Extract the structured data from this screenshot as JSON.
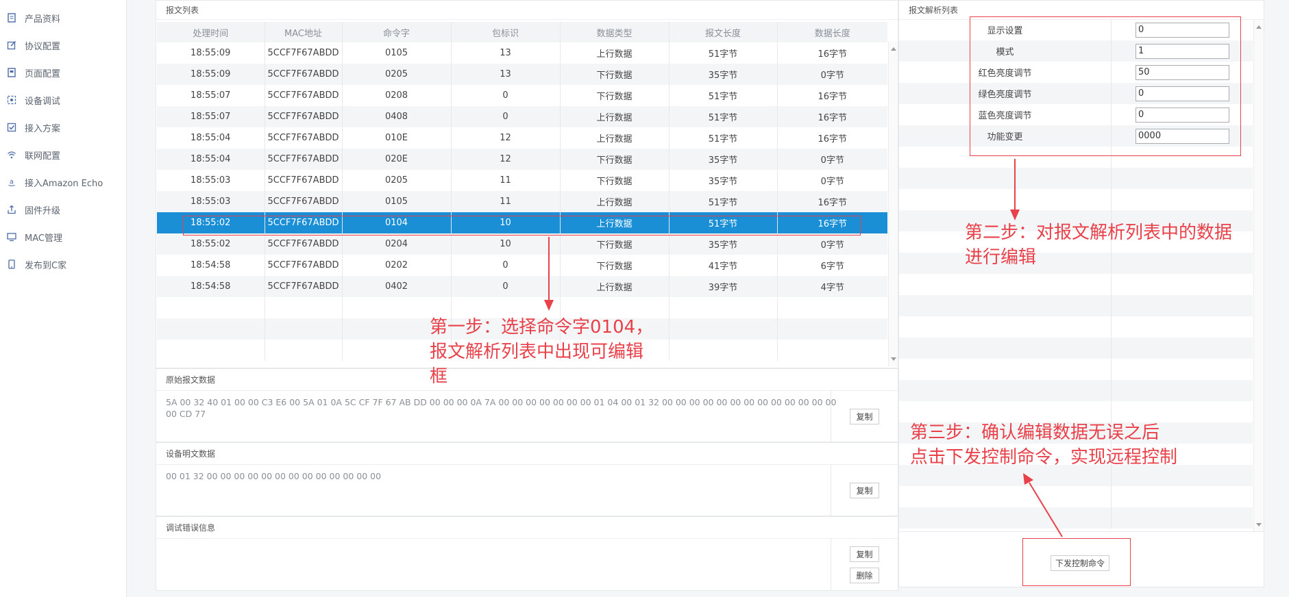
{
  "sidebar": {
    "items": [
      {
        "label": "产品资料",
        "icon": "document-icon"
      },
      {
        "label": "协议配置",
        "icon": "edit-icon"
      },
      {
        "label": "页面配置",
        "icon": "page-icon"
      },
      {
        "label": "设备调试",
        "icon": "debug-icon"
      },
      {
        "label": "接入方案",
        "icon": "checkbox-icon"
      },
      {
        "label": "联网配置",
        "icon": "wifi-icon"
      },
      {
        "label": "接入Amazon Echo",
        "icon": "amazon-icon"
      },
      {
        "label": "固件升级",
        "icon": "upload-icon"
      },
      {
        "label": "MAC管理",
        "icon": "monitor-icon"
      },
      {
        "label": "发布到C家",
        "icon": "phone-icon"
      }
    ]
  },
  "list": {
    "title": "报文列表",
    "columns": [
      "处理时间",
      "MAC地址",
      "命令字",
      "包标识",
      "数据类型",
      "报文长度",
      "数据长度"
    ],
    "rows": [
      [
        "18:55:09",
        "5CCF7F67ABDD",
        "0105",
        "13",
        "上行数据",
        "51字节",
        "16字节"
      ],
      [
        "18:55:09",
        "5CCF7F67ABDD",
        "0205",
        "13",
        "下行数据",
        "35字节",
        "0字节"
      ],
      [
        "18:55:07",
        "5CCF7F67ABDD",
        "0208",
        "0",
        "下行数据",
        "51字节",
        "16字节"
      ],
      [
        "18:55:07",
        "5CCF7F67ABDD",
        "0408",
        "0",
        "上行数据",
        "51字节",
        "16字节"
      ],
      [
        "18:55:04",
        "5CCF7F67ABDD",
        "010E",
        "12",
        "上行数据",
        "51字节",
        "16字节"
      ],
      [
        "18:55:04",
        "5CCF7F67ABDD",
        "020E",
        "12",
        "下行数据",
        "35字节",
        "0字节"
      ],
      [
        "18:55:03",
        "5CCF7F67ABDD",
        "0205",
        "11",
        "下行数据",
        "35字节",
        "0字节"
      ],
      [
        "18:55:03",
        "5CCF7F67ABDD",
        "0105",
        "11",
        "上行数据",
        "51字节",
        "16字节"
      ],
      [
        "18:55:02",
        "5CCF7F67ABDD",
        "0104",
        "10",
        "上行数据",
        "51字节",
        "16字节"
      ],
      [
        "18:55:02",
        "5CCF7F67ABDD",
        "0204",
        "10",
        "下行数据",
        "35字节",
        "0字节"
      ],
      [
        "18:54:58",
        "5CCF7F67ABDD",
        "0202",
        "0",
        "下行数据",
        "41字节",
        "6字节"
      ],
      [
        "18:54:58",
        "5CCF7F67ABDD",
        "0402",
        "0",
        "上行数据",
        "39字节",
        "4字节"
      ]
    ],
    "selected_index": 8
  },
  "raw": {
    "title": "原始报文数据",
    "text": "5A 00 32 40 01 00 00 C3 E6 00 5A 01 0A 5C CF 7F 67 AB DD 00 00 00 0A 7A 00 00 00 00 00 00 00 01 04 00 01 32 00 00 00 00 00 00 00 00 00 00 00 00 00 00 CD 77",
    "copy": "复制"
  },
  "plain": {
    "title": "设备明文数据",
    "text": "00 01 32 00 00 00 00 00 00 00 00 00 00 00 00 00",
    "copy": "复制"
  },
  "errors": {
    "title": "调试错误信息",
    "text": "",
    "copy": "复制",
    "delete": "删除"
  },
  "parse": {
    "title": "报文解析列表",
    "fields": [
      {
        "label": "显示设置",
        "value": "0"
      },
      {
        "label": "模式",
        "value": "1"
      },
      {
        "label": "红色亮度调节",
        "value": "50"
      },
      {
        "label": "绿色亮度调节",
        "value": "0"
      },
      {
        "label": "蓝色亮度调节",
        "value": "0"
      },
      {
        "label": "功能变更",
        "value": "0000"
      }
    ],
    "send": "下发控制命令"
  },
  "notes": {
    "step1": [
      "第一步：选择命令字0104，",
      "报文解析列表中出现可编辑",
      "框"
    ],
    "step2": [
      "第二步：对报文解析列表中的数据",
      "进行编辑"
    ],
    "step3": [
      "第三步：确认编辑数据无误之后",
      "点击下发控制命令，实现远程控制"
    ]
  },
  "colors": {
    "accent": "#1a8fd6",
    "annotation": "#e8414a",
    "sidebar_icon": "#4a6aa8"
  }
}
